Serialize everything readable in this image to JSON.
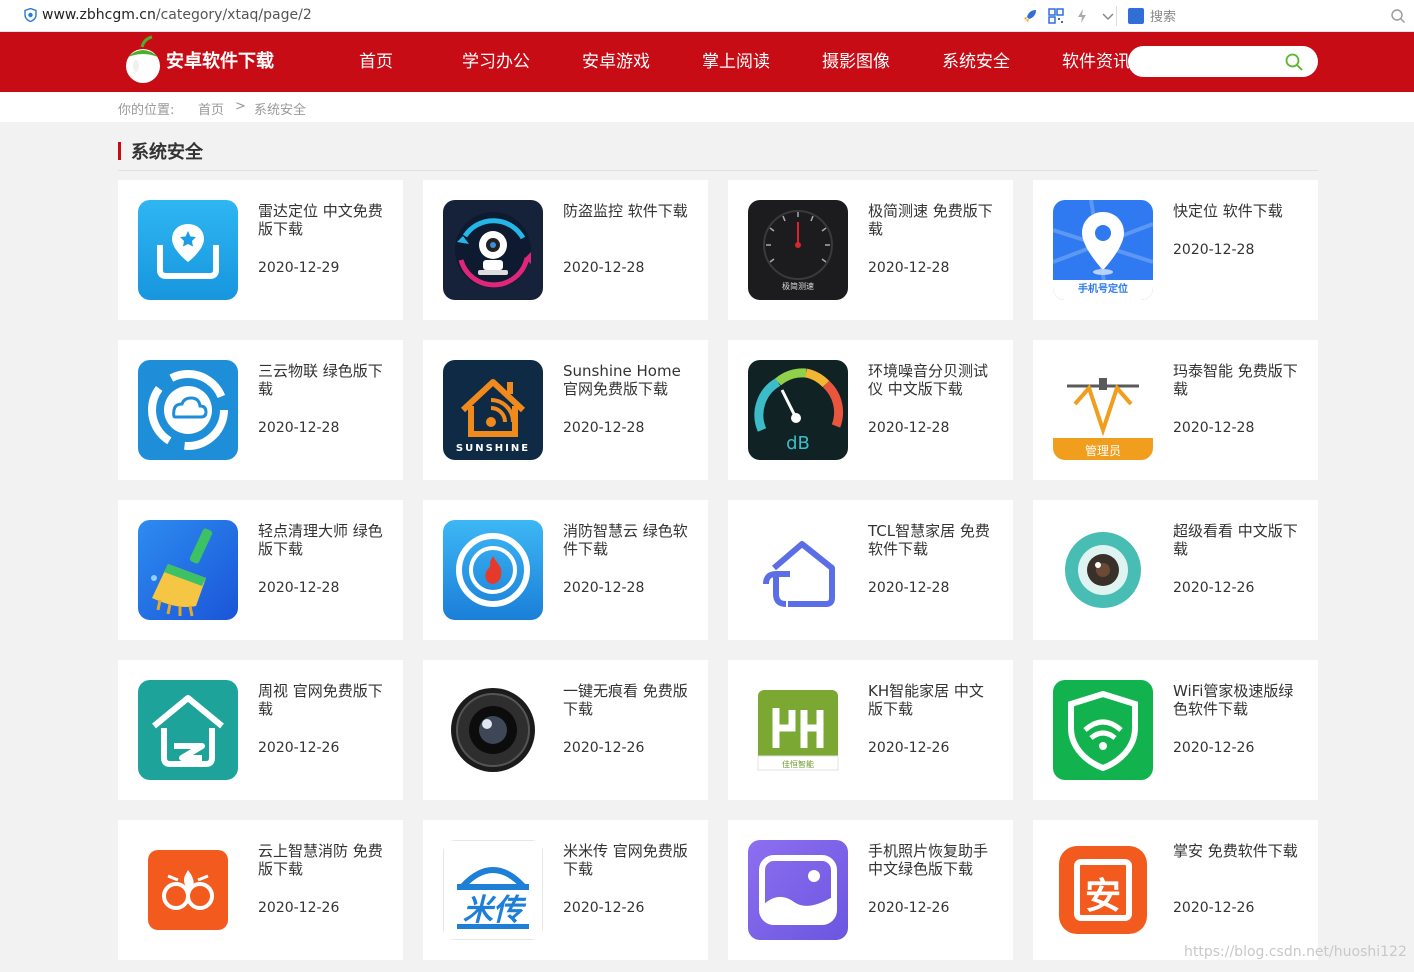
{
  "browser": {
    "url_domain": "www.zbhcgm.cn",
    "url_path": "/category/xtaq/page/2",
    "search_label": "搜索"
  },
  "header": {
    "logo_text": "安卓软件下载",
    "nav": [
      "首页",
      "学习办公",
      "安卓游戏",
      "掌上阅读",
      "摄影图像",
      "系统安全",
      "软件资讯"
    ],
    "search_placeholder": ""
  },
  "breadcrumb": {
    "prefix": "你的位置:",
    "home": "首页",
    "separator": ">",
    "current": "系统安全"
  },
  "section": {
    "title": "系统安全"
  },
  "cards": [
    {
      "name": "雷达定位 中文免费版下载",
      "date": "2020-12-29",
      "icon": "radar-locate-icon"
    },
    {
      "name": "防盗监控 软件下载",
      "date": "2020-12-28",
      "icon": "security-camera-icon"
    },
    {
      "name": "极简测速 免费版下载",
      "date": "2020-12-28",
      "icon": "speedometer-icon",
      "icon_text": "极简测速"
    },
    {
      "name": "快定位 软件下载",
      "date": "2020-12-28",
      "icon": "map-pin-icon",
      "icon_text": "手机号定位"
    },
    {
      "name": "三云物联 绿色版下载",
      "date": "2020-12-28",
      "icon": "cloud-sync-icon"
    },
    {
      "name": "Sunshine Home 官网免费版下载",
      "date": "2020-12-28",
      "icon": "sunshine-home-icon",
      "icon_text": "SUNSHINE"
    },
    {
      "name": "环境噪音分贝测试仪 中文版下载",
      "date": "2020-12-28",
      "icon": "decibel-meter-icon",
      "icon_text": "dB"
    },
    {
      "name": "玛泰智能 免费版下载",
      "date": "2020-12-28",
      "icon": "matai-logo-icon",
      "icon_text": "管理员"
    },
    {
      "name": "轻点清理大师 绿色版下载",
      "date": "2020-12-28",
      "icon": "broom-cleaner-icon"
    },
    {
      "name": "消防智慧云 绿色软件下载",
      "date": "2020-12-28",
      "icon": "fire-target-icon"
    },
    {
      "name": "TCL智慧家居 免费软件下载",
      "date": "2020-12-28",
      "icon": "tcl-home-icon"
    },
    {
      "name": "超级看看 中文版下载",
      "date": "2020-12-26",
      "icon": "lens-eye-icon"
    },
    {
      "name": "周视 官网免费版下载",
      "date": "2020-12-26",
      "icon": "house-outline-icon"
    },
    {
      "name": "一键无痕看 免费版下载",
      "date": "2020-12-26",
      "icon": "camera-lens-icon"
    },
    {
      "name": "KH智能家居 中文版下载",
      "date": "2020-12-26",
      "icon": "kh-logo-icon",
      "icon_text": "佳恒智能"
    },
    {
      "name": "WiFi管家极速版绿色软件下载",
      "date": "2020-12-26",
      "icon": "wifi-shield-icon"
    },
    {
      "name": "云上智慧消防 免费版下载",
      "date": "2020-12-26",
      "icon": "fire-emblem-icon"
    },
    {
      "name": "米米传 官网免费版下载",
      "date": "2020-12-26",
      "icon": "mimichuan-logo-icon",
      "icon_text": "米传"
    },
    {
      "name": "手机照片恢复助手 中文绿色版下载",
      "date": "2020-12-26",
      "icon": "photo-recover-icon"
    },
    {
      "name": "掌安 免费软件下载",
      "date": "2020-12-26",
      "icon": "zhangan-logo-icon",
      "icon_text": "安"
    }
  ],
  "watermark": "https://blog.csdn.net/huoshi122"
}
